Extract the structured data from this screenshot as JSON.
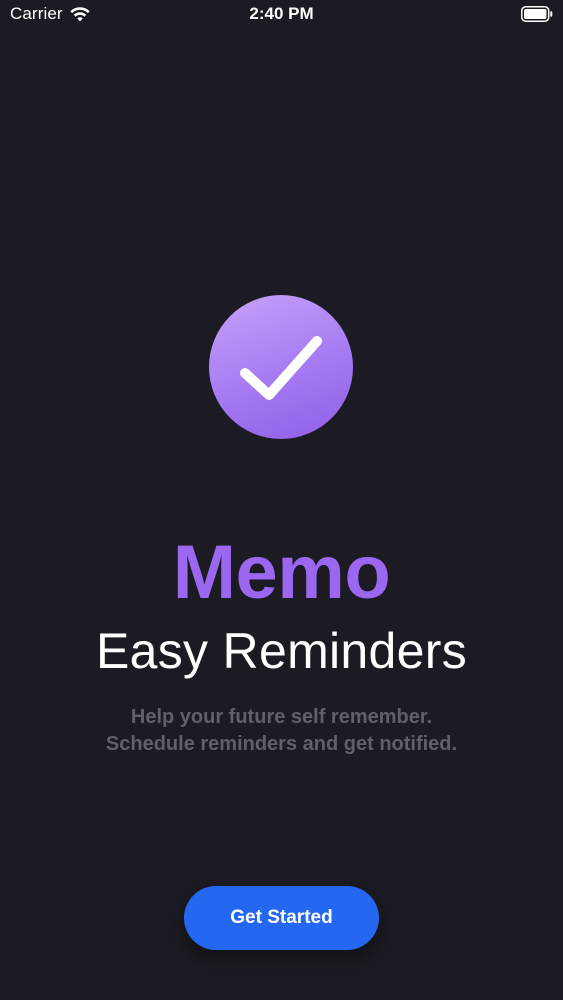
{
  "status_bar": {
    "carrier": "Carrier",
    "time": "2:40 PM",
    "wifi_icon": "wifi-icon",
    "battery_icon": "battery-icon"
  },
  "logo": {
    "icon": "checkmark-icon",
    "colors": {
      "gradient_start": "#c8a2fb",
      "gradient_end": "#8f5ee8"
    }
  },
  "app_name": "Memo",
  "subtitle": "Easy Reminders",
  "description": {
    "line1": "Help your future self remember.",
    "line2": "Schedule reminders and get notified."
  },
  "cta": {
    "label": "Get Started",
    "color": "#2468f2"
  },
  "colors": {
    "background": "#1c1b23",
    "accent": "#9b66f0",
    "muted_text": "#5f6068"
  }
}
